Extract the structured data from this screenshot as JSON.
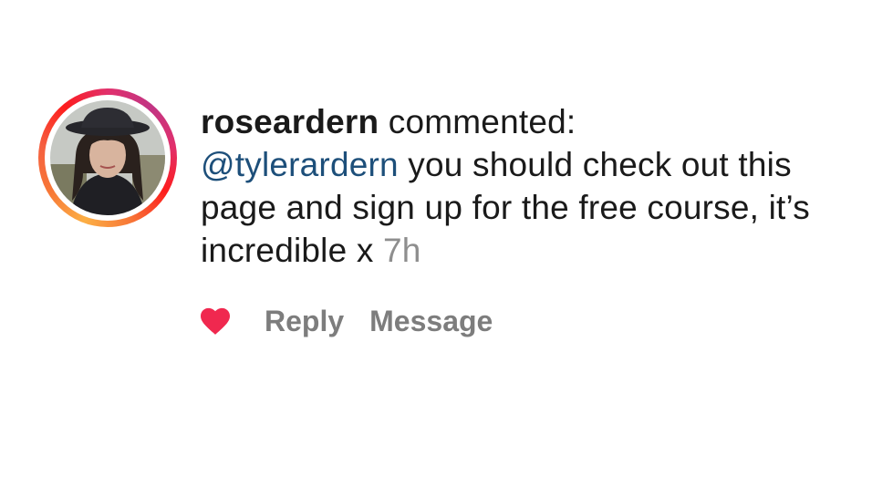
{
  "comment": {
    "username": "roseardern",
    "action_text": " commented:",
    "mention": "@tylerardern",
    "body": " you should check out this page and sign up for the free course, it’s incredible x ",
    "time": "7h"
  },
  "actions": {
    "reply_label": "Reply",
    "message_label": "Message"
  },
  "icons": {
    "like": "heart-icon",
    "like_color": "#f0284f"
  },
  "colors": {
    "mention": "#1d4f7a",
    "secondary_text": "#8e8e8e"
  }
}
